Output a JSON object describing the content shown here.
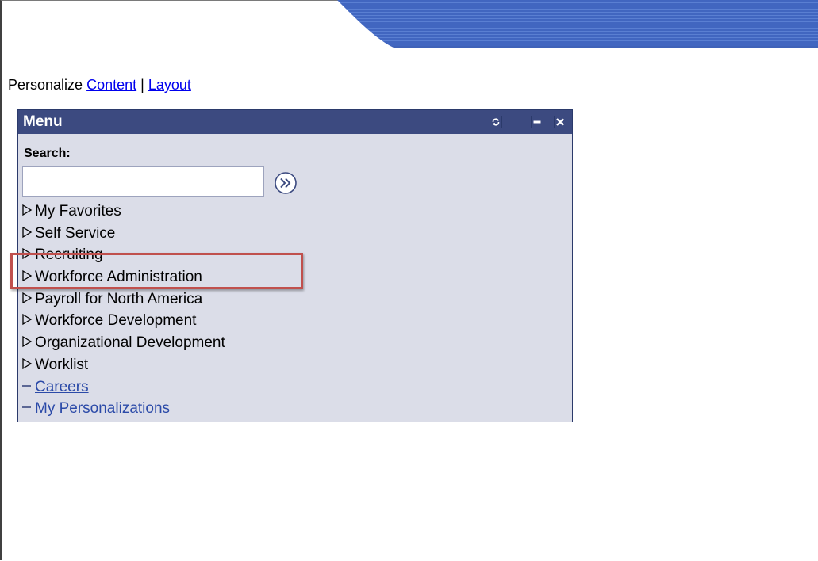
{
  "personalize": {
    "label": "Personalize",
    "content_link": "Content",
    "separator": "|",
    "layout_link": "Layout"
  },
  "menu": {
    "title": "Menu",
    "header_buttons": [
      "refresh-icon",
      "minimize-icon",
      "close-icon"
    ],
    "search_label": "Search:",
    "search_value": "",
    "go_icon": "double-chevron-right-icon",
    "folders": [
      "My Favorites",
      "Self Service",
      "Recruiting",
      "Workforce Administration",
      "Payroll for North America",
      "Workforce Development",
      "Organizational Development",
      "Worklist"
    ],
    "links": [
      "Careers",
      "My Personalizations"
    ]
  },
  "highlighted_item": "Workforce Administration",
  "colors": {
    "header_bg": "#3c4a80",
    "panel_bg": "#dbdde8",
    "banner_blue": "#3f62b8",
    "link": "#0000ee",
    "menu_link": "#2b4aa8",
    "highlight_border": "#c0504d"
  }
}
